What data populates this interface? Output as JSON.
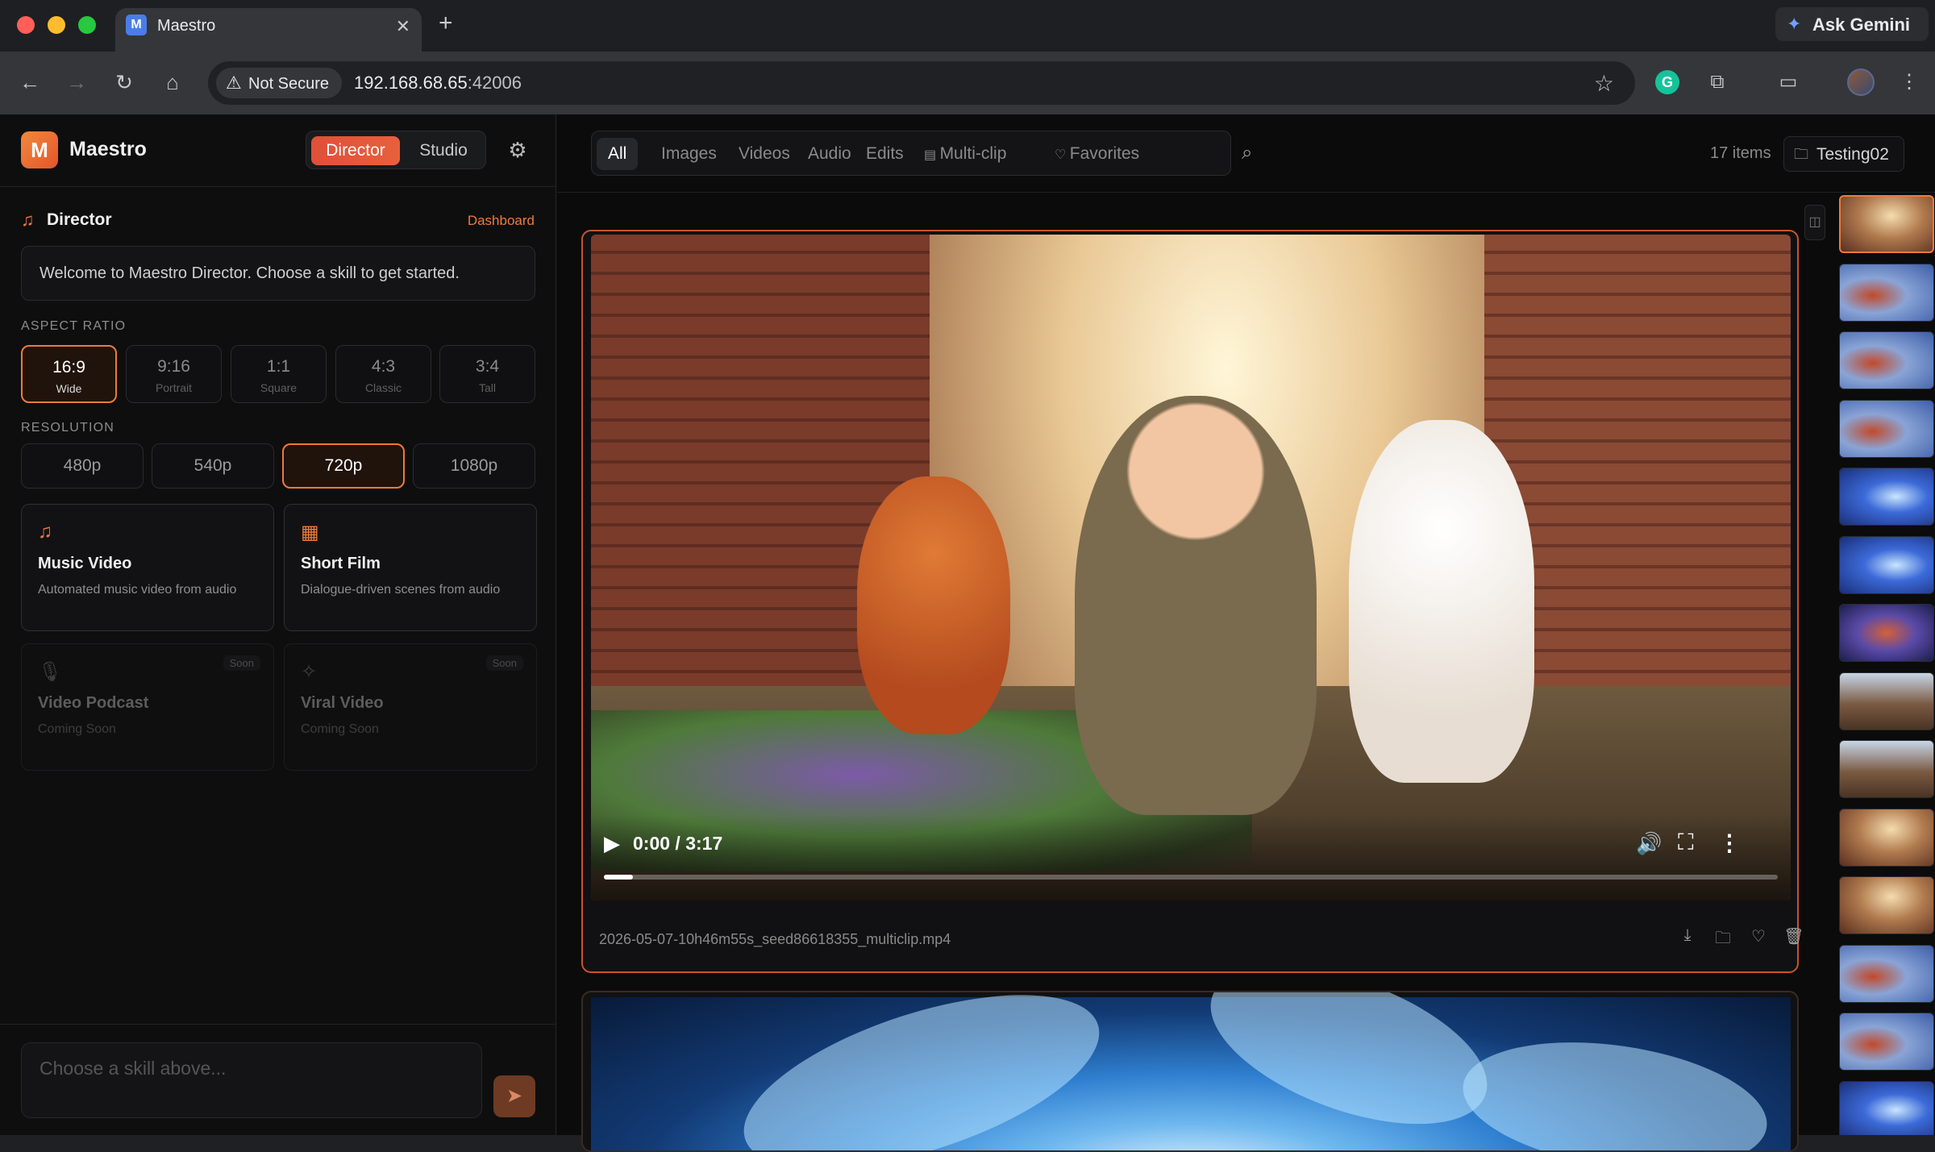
{
  "browser": {
    "tab_title": "Maestro",
    "tab_favicon_letter": "M",
    "ask_gemini": "Ask Gemini",
    "security_label": "Not Secure",
    "url_host": "192.168.68.65",
    "url_port": ":42006"
  },
  "sidebar": {
    "logo_letter": "M",
    "app_name": "Maestro",
    "modes": [
      "Director",
      "Studio"
    ],
    "active_mode": "Director",
    "section_title": "Director",
    "dashboard_link": "Dashboard",
    "welcome_message": "Welcome to Maestro Director. Choose a skill to get started.",
    "aspect_ratio_label": "ASPECT RATIO",
    "aspect_ratios": [
      {
        "value": "16:9",
        "name": "Wide"
      },
      {
        "value": "9:16",
        "name": "Portrait"
      },
      {
        "value": "1:1",
        "name": "Square"
      },
      {
        "value": "4:3",
        "name": "Classic"
      },
      {
        "value": "3:4",
        "name": "Tall"
      }
    ],
    "selected_aspect_ratio": "16:9",
    "resolution_label": "RESOLUTION",
    "resolutions": [
      "480p",
      "540p",
      "720p",
      "1080p"
    ],
    "selected_resolution": "720p",
    "skills": [
      {
        "title": "Music Video",
        "description": "Automated music video from audio",
        "icon": "music-note-icon",
        "status": "available"
      },
      {
        "title": "Short Film",
        "description": "Dialogue-driven scenes from audio",
        "icon": "film-icon",
        "status": "available"
      },
      {
        "title": "Video Podcast",
        "description": "Coming Soon",
        "icon": "microphone-icon",
        "status": "soon",
        "badge": "Soon"
      },
      {
        "title": "Viral Video",
        "description": "Coming Soon",
        "icon": "sparkle-icon",
        "status": "soon",
        "badge": "Soon"
      }
    ],
    "chat_placeholder": "Choose a skill above..."
  },
  "gallery": {
    "filters": [
      "All",
      "Images",
      "Videos",
      "Audio",
      "Edits",
      "Multi-clip",
      "Favorites"
    ],
    "active_filter": "All",
    "item_count": "17 items",
    "folder_name": "Testing02",
    "featured": {
      "filename": "2026-05-07-10h46m55s_seed86618355_multiclip.mp4",
      "time": "0:00 / 3:17",
      "progress": 0.025
    },
    "thumbnails": [
      "alley",
      "blue",
      "blue",
      "blue",
      "flower",
      "flower",
      "purple",
      "street",
      "street",
      "alley",
      "alley",
      "blue",
      "blue",
      "flower"
    ]
  },
  "colors": {
    "accent": "#ee7a3c",
    "director_active": "#df4f3a",
    "background": "#0b0b0c"
  }
}
